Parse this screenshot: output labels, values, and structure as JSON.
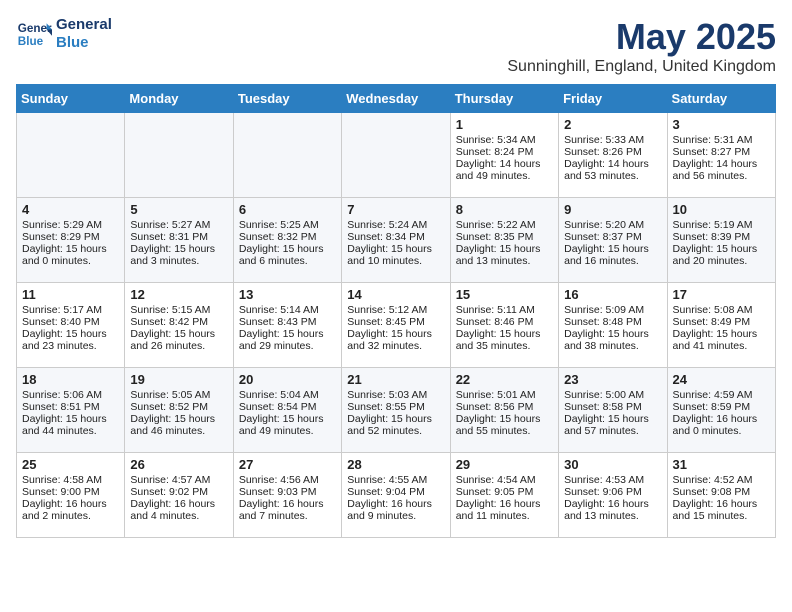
{
  "header": {
    "logo_line1": "General",
    "logo_line2": "Blue",
    "month": "May 2025",
    "location": "Sunninghill, England, United Kingdom"
  },
  "days_of_week": [
    "Sunday",
    "Monday",
    "Tuesday",
    "Wednesday",
    "Thursday",
    "Friday",
    "Saturday"
  ],
  "weeks": [
    [
      {
        "day": "",
        "info": ""
      },
      {
        "day": "",
        "info": ""
      },
      {
        "day": "",
        "info": ""
      },
      {
        "day": "",
        "info": ""
      },
      {
        "day": "1",
        "info": "Sunrise: 5:34 AM\nSunset: 8:24 PM\nDaylight: 14 hours\nand 49 minutes."
      },
      {
        "day": "2",
        "info": "Sunrise: 5:33 AM\nSunset: 8:26 PM\nDaylight: 14 hours\nand 53 minutes."
      },
      {
        "day": "3",
        "info": "Sunrise: 5:31 AM\nSunset: 8:27 PM\nDaylight: 14 hours\nand 56 minutes."
      }
    ],
    [
      {
        "day": "4",
        "info": "Sunrise: 5:29 AM\nSunset: 8:29 PM\nDaylight: 15 hours\nand 0 minutes."
      },
      {
        "day": "5",
        "info": "Sunrise: 5:27 AM\nSunset: 8:31 PM\nDaylight: 15 hours\nand 3 minutes."
      },
      {
        "day": "6",
        "info": "Sunrise: 5:25 AM\nSunset: 8:32 PM\nDaylight: 15 hours\nand 6 minutes."
      },
      {
        "day": "7",
        "info": "Sunrise: 5:24 AM\nSunset: 8:34 PM\nDaylight: 15 hours\nand 10 minutes."
      },
      {
        "day": "8",
        "info": "Sunrise: 5:22 AM\nSunset: 8:35 PM\nDaylight: 15 hours\nand 13 minutes."
      },
      {
        "day": "9",
        "info": "Sunrise: 5:20 AM\nSunset: 8:37 PM\nDaylight: 15 hours\nand 16 minutes."
      },
      {
        "day": "10",
        "info": "Sunrise: 5:19 AM\nSunset: 8:39 PM\nDaylight: 15 hours\nand 20 minutes."
      }
    ],
    [
      {
        "day": "11",
        "info": "Sunrise: 5:17 AM\nSunset: 8:40 PM\nDaylight: 15 hours\nand 23 minutes."
      },
      {
        "day": "12",
        "info": "Sunrise: 5:15 AM\nSunset: 8:42 PM\nDaylight: 15 hours\nand 26 minutes."
      },
      {
        "day": "13",
        "info": "Sunrise: 5:14 AM\nSunset: 8:43 PM\nDaylight: 15 hours\nand 29 minutes."
      },
      {
        "day": "14",
        "info": "Sunrise: 5:12 AM\nSunset: 8:45 PM\nDaylight: 15 hours\nand 32 minutes."
      },
      {
        "day": "15",
        "info": "Sunrise: 5:11 AM\nSunset: 8:46 PM\nDaylight: 15 hours\nand 35 minutes."
      },
      {
        "day": "16",
        "info": "Sunrise: 5:09 AM\nSunset: 8:48 PM\nDaylight: 15 hours\nand 38 minutes."
      },
      {
        "day": "17",
        "info": "Sunrise: 5:08 AM\nSunset: 8:49 PM\nDaylight: 15 hours\nand 41 minutes."
      }
    ],
    [
      {
        "day": "18",
        "info": "Sunrise: 5:06 AM\nSunset: 8:51 PM\nDaylight: 15 hours\nand 44 minutes."
      },
      {
        "day": "19",
        "info": "Sunrise: 5:05 AM\nSunset: 8:52 PM\nDaylight: 15 hours\nand 46 minutes."
      },
      {
        "day": "20",
        "info": "Sunrise: 5:04 AM\nSunset: 8:54 PM\nDaylight: 15 hours\nand 49 minutes."
      },
      {
        "day": "21",
        "info": "Sunrise: 5:03 AM\nSunset: 8:55 PM\nDaylight: 15 hours\nand 52 minutes."
      },
      {
        "day": "22",
        "info": "Sunrise: 5:01 AM\nSunset: 8:56 PM\nDaylight: 15 hours\nand 55 minutes."
      },
      {
        "day": "23",
        "info": "Sunrise: 5:00 AM\nSunset: 8:58 PM\nDaylight: 15 hours\nand 57 minutes."
      },
      {
        "day": "24",
        "info": "Sunrise: 4:59 AM\nSunset: 8:59 PM\nDaylight: 16 hours\nand 0 minutes."
      }
    ],
    [
      {
        "day": "25",
        "info": "Sunrise: 4:58 AM\nSunset: 9:00 PM\nDaylight: 16 hours\nand 2 minutes."
      },
      {
        "day": "26",
        "info": "Sunrise: 4:57 AM\nSunset: 9:02 PM\nDaylight: 16 hours\nand 4 minutes."
      },
      {
        "day": "27",
        "info": "Sunrise: 4:56 AM\nSunset: 9:03 PM\nDaylight: 16 hours\nand 7 minutes."
      },
      {
        "day": "28",
        "info": "Sunrise: 4:55 AM\nSunset: 9:04 PM\nDaylight: 16 hours\nand 9 minutes."
      },
      {
        "day": "29",
        "info": "Sunrise: 4:54 AM\nSunset: 9:05 PM\nDaylight: 16 hours\nand 11 minutes."
      },
      {
        "day": "30",
        "info": "Sunrise: 4:53 AM\nSunset: 9:06 PM\nDaylight: 16 hours\nand 13 minutes."
      },
      {
        "day": "31",
        "info": "Sunrise: 4:52 AM\nSunset: 9:08 PM\nDaylight: 16 hours\nand 15 minutes."
      }
    ]
  ]
}
